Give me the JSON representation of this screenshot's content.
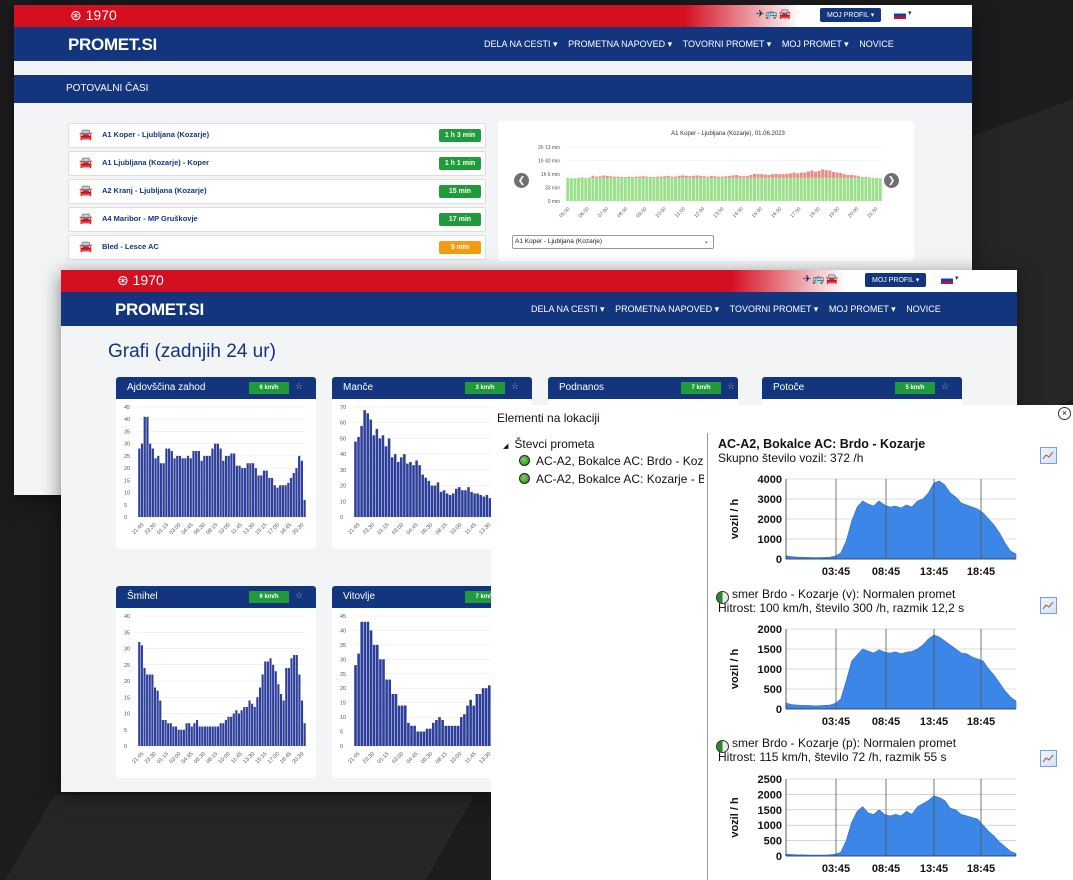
{
  "colors": {
    "red": "#d40f20",
    "navy": "#12357e",
    "green": "#1f9b3b",
    "orange": "#f39c12",
    "bar": "#2d3f9b",
    "fill": "#3b86e6"
  },
  "topbar": {
    "phone_icon": "phone-circle-icon",
    "phone": "1970",
    "transport_icons": "✈🚌🚘",
    "profile_label": "MOJ PROFIL ▾",
    "language_dropdown": "▾"
  },
  "nav": {
    "logo": "PROMET.SI",
    "items": [
      "DELA NA CESTI ▾",
      "PROMETNA NAPOVED ▾",
      "TOVORNI PROMET ▾",
      "MOJ PROMET ▾",
      "NOVICE"
    ]
  },
  "travel": {
    "section_title": "POTOVALNI ČASI",
    "routes": [
      {
        "name": "A1 Koper - Ljubljana (Kozarje)",
        "time": "1 h 3 min",
        "status": "green"
      },
      {
        "name": "A1 Ljubljana (Kozarje) - Koper",
        "time": "1 h 1 min",
        "status": "green"
      },
      {
        "name": "A2 Kranj - Ljubljana (Kozarje)",
        "time": "15 min",
        "status": "green"
      },
      {
        "name": "A4 Maribor - MP Gruškovje",
        "time": "17 min",
        "status": "green"
      },
      {
        "name": "Bled - Lesce AC",
        "time": "5 min",
        "status": "orange"
      }
    ],
    "chart": {
      "title": "A1 Koper - Ljubljana (Kozarje), 01.06.2023",
      "y_ticks": [
        "2h 13 min",
        "1h 40 min",
        "1h 6 min",
        "33 min",
        "0 min"
      ],
      "x_ticks": [
        "05:00",
        "06:00",
        "07:00",
        "08:00",
        "09:00",
        "10:00",
        "11:00",
        "12:00",
        "13:00",
        "14:00",
        "15:00",
        "16:00",
        "17:00",
        "18:00",
        "19:00",
        "20:00",
        "21:00"
      ],
      "select_value": "A1 Koper - Ljubljana (Kozarje)"
    }
  },
  "grafi": {
    "title": "Grafi (zadnjih 24 ur)",
    "sensors": [
      {
        "name": "Ajdovščina zahod",
        "speed": "6 km/h",
        "y_ticks": [
          "45",
          "40",
          "35",
          "30",
          "25",
          "20",
          "15",
          "10",
          "5",
          "0"
        ],
        "x_ticks": [
          "21:45",
          "23:30",
          "01:15",
          "03:00",
          "04:45",
          "06:30",
          "08:15",
          "10:00",
          "11:45",
          "13:30",
          "15:15",
          "17:00",
          "18:45",
          "20:30"
        ]
      },
      {
        "name": "Manče",
        "speed": "3 km/h",
        "y_ticks": [
          "70",
          "60",
          "50",
          "40",
          "30",
          "20",
          "10",
          "0"
        ],
        "x_ticks": [
          "21:45",
          "23:30",
          "01:15",
          "03:00",
          "04:45",
          "06:30",
          "08:15",
          "10:00",
          "11:45",
          "13:30",
          "15:15",
          "17:00"
        ]
      },
      {
        "name": "Podnanos",
        "speed": "7 km/h"
      },
      {
        "name": "Potoče",
        "speed": "5 km/h"
      },
      {
        "name": "Šmihel",
        "speed": "6 km/h",
        "y_ticks": [
          "40",
          "35",
          "30",
          "25",
          "20",
          "15",
          "10",
          "5",
          "0"
        ],
        "x_ticks": [
          "21:45",
          "23:30",
          "01:15",
          "03:00",
          "04:45",
          "06:30",
          "08:15",
          "10:00",
          "11:45",
          "13:30",
          "15:15",
          "17:00",
          "18:45",
          "20:30"
        ]
      },
      {
        "name": "Vitovlje",
        "speed": "7 km/h",
        "y_ticks": [
          "45",
          "40",
          "35",
          "30",
          "25",
          "20",
          "15",
          "10",
          "5",
          "0"
        ],
        "x_ticks": [
          "21:45",
          "23:30",
          "01:15",
          "03:00",
          "04:45",
          "06:30",
          "08:15",
          "10:00",
          "11:45",
          "13:30",
          "15:15",
          "17:00"
        ]
      }
    ]
  },
  "popup": {
    "title": "Elementi na lokaciji",
    "close_icon": "close-circle-icon",
    "tree_label": "Števci prometa",
    "leaves": [
      "AC-A2, Bokalce AC: Brdo - Kozarje",
      "AC-A2, Bokalce AC: Kozarje - Brdo"
    ],
    "heading": "AC-A2, Bokalce AC: Brdo - Kozarje",
    "total": "Skupno število vozil: 372 /h",
    "dir1_line1": "smer Brdo - Kozarje (v): Normalen promet",
    "dir1_line2": "Hitrost: 100 km/h, število 300 /h, razmik 12,2 s",
    "dir2_line1": "smer Brdo - Kozarje (p): Normalen promet",
    "dir2_line2": "Hitrost: 115 km/h, število 72 /h, razmik 55 s",
    "y_label": "vozil / h",
    "x_ticks": [
      "03:45",
      "08:45",
      "13:45",
      "18:45"
    ],
    "chart_y_ticks": [
      [
        "4000",
        "3000",
        "2000",
        "1000",
        "0"
      ],
      [
        "2000",
        "1500",
        "1000",
        "500",
        "0"
      ],
      [
        "2500",
        "2000",
        "1500",
        "1000",
        "500",
        "0"
      ]
    ]
  },
  "chart_data": [
    {
      "type": "bar",
      "title": "A1 Koper - Ljubljana (Kozarje), 01.06.2023",
      "x": [
        "05:00",
        "06:00",
        "07:00",
        "08:00",
        "09:00",
        "10:00",
        "11:00",
        "12:00",
        "13:00",
        "14:00",
        "15:00",
        "16:00",
        "17:00",
        "18:00",
        "19:00",
        "20:00",
        "21:00"
      ],
      "series": [
        {
          "values": [
            57,
            56,
            56,
            57,
            58,
            57,
            58,
            62,
            60,
            61,
            63,
            62,
            61,
            60,
            60,
            59,
            59,
            60,
            59,
            60,
            60,
            61,
            60,
            59,
            59,
            60,
            60,
            61,
            62,
            60,
            60,
            62,
            63,
            62,
            61,
            62,
            63,
            62,
            61,
            60,
            62,
            61,
            60,
            60,
            61,
            62,
            63,
            64,
            62,
            61,
            62,
            64,
            67,
            66,
            66,
            65,
            64,
            66,
            67,
            66,
            66,
            67,
            68,
            70,
            68,
            70,
            70,
            73,
            75,
            72,
            74,
            78,
            76,
            75,
            71,
            70,
            69,
            66,
            64,
            64,
            63,
            61,
            59,
            59,
            58,
            57,
            57,
            56
          ]
        }
      ]
    },
    {
      "type": "bar",
      "title": "Ajdovščina zahod",
      "ylim": [
        0,
        45
      ],
      "series": [
        {
          "values": [
            28,
            30,
            41,
            41,
            30,
            28,
            24,
            25,
            22,
            22,
            28,
            28,
            27,
            24,
            25,
            25,
            24,
            24,
            25,
            24,
            27,
            27,
            27,
            23,
            25,
            25,
            25,
            28,
            30,
            30,
            28,
            23,
            25,
            25,
            26,
            26,
            21,
            21,
            20,
            20,
            22,
            22,
            22,
            20,
            17,
            17,
            19,
            19,
            16,
            16,
            13,
            12,
            13,
            13,
            13,
            14,
            16,
            18,
            20,
            25,
            23,
            7
          ]
        }
      ]
    },
    {
      "type": "bar",
      "title": "Manče",
      "ylim": [
        0,
        70
      ],
      "series": [
        {
          "values": [
            48,
            51,
            58,
            68,
            66,
            62,
            52,
            56,
            50,
            52,
            45,
            50,
            38,
            40,
            35,
            38,
            40,
            34,
            35,
            33,
            36,
            33,
            27,
            25,
            23,
            20,
            20,
            22,
            16,
            17,
            15,
            14,
            15,
            18,
            19,
            17,
            17,
            19,
            16,
            15,
            15,
            14,
            13,
            14,
            12,
            11,
            12,
            20,
            21,
            22,
            22,
            17,
            16,
            13,
            10
          ]
        }
      ]
    },
    {
      "type": "bar",
      "title": "Šmihel",
      "ylim": [
        0,
        40
      ],
      "series": [
        {
          "values": [
            32,
            31,
            24,
            22,
            22,
            22,
            18,
            17,
            14,
            8,
            8,
            7,
            7,
            6,
            6,
            5,
            5,
            5,
            7,
            7,
            6,
            7,
            8,
            6,
            6,
            6,
            6,
            6,
            6,
            6,
            6,
            7,
            7,
            8,
            9,
            9,
            10,
            11,
            10,
            11,
            12,
            12,
            14,
            13,
            12,
            15,
            18,
            22,
            26,
            26,
            27,
            25,
            23,
            19,
            16,
            14,
            24,
            24,
            27,
            28,
            28,
            22,
            14,
            7
          ]
        }
      ]
    },
    {
      "type": "bar",
      "title": "Vitovlje",
      "ylim": [
        0,
        45
      ],
      "series": [
        {
          "values": [
            28,
            32,
            43,
            43,
            43,
            40,
            35,
            35,
            30,
            30,
            23,
            23,
            18,
            18,
            14,
            14,
            14,
            8,
            7,
            7,
            5,
            5,
            5,
            6,
            6,
            8,
            9,
            10,
            9,
            7,
            7,
            7,
            7,
            7,
            10,
            11,
            14,
            16,
            14,
            18,
            18,
            20,
            20,
            21,
            18,
            18,
            21,
            21,
            18,
            18,
            17,
            17,
            17,
            17
          ]
        }
      ]
    },
    {
      "type": "area",
      "title": "AC-A2, Bokalce AC: Brdo - Kozarje",
      "ylabel": "vozil / h",
      "ylim": [
        0,
        4000
      ],
      "series": [
        {
          "values": [
            160,
            120,
            100,
            90,
            80,
            70,
            70,
            80,
            90,
            150,
            300,
            900,
            1900,
            2600,
            2900,
            2750,
            2650,
            2900,
            2700,
            2600,
            2650,
            2550,
            2700,
            2600,
            2900,
            3000,
            3300,
            3800,
            3900,
            3700,
            3300,
            3100,
            2800,
            2700,
            2600,
            2500,
            2300,
            2000,
            1700,
            1300,
            800,
            400,
            250
          ]
        }
      ]
    },
    {
      "type": "area",
      "title": "smer Brdo - Kozarje (v)",
      "ylabel": "vozil / h",
      "ylim": [
        0,
        2000
      ],
      "series": [
        {
          "values": [
            150,
            110,
            100,
            90,
            90,
            80,
            80,
            90,
            100,
            140,
            250,
            700,
            1200,
            1350,
            1500,
            1450,
            1400,
            1480,
            1420,
            1400,
            1430,
            1380,
            1420,
            1440,
            1500,
            1600,
            1750,
            1850,
            1800,
            1700,
            1600,
            1500,
            1400,
            1380,
            1300,
            1250,
            1200,
            1000,
            850,
            650,
            450,
            300,
            200
          ]
        }
      ]
    },
    {
      "type": "area",
      "title": "smer Brdo - Kozarje (p)",
      "ylabel": "vozil / h",
      "ylim": [
        0,
        2500
      ],
      "series": [
        {
          "values": [
            60,
            50,
            40,
            40,
            30,
            30,
            30,
            30,
            40,
            60,
            120,
            500,
            1100,
            1450,
            1600,
            1400,
            1350,
            1500,
            1350,
            1300,
            1350,
            1300,
            1450,
            1350,
            1600,
            1700,
            1800,
            1950,
            1900,
            1800,
            1550,
            1500,
            1350,
            1300,
            1250,
            1200,
            1000,
            800,
            650,
            450,
            300,
            150,
            80
          ]
        }
      ]
    }
  ]
}
